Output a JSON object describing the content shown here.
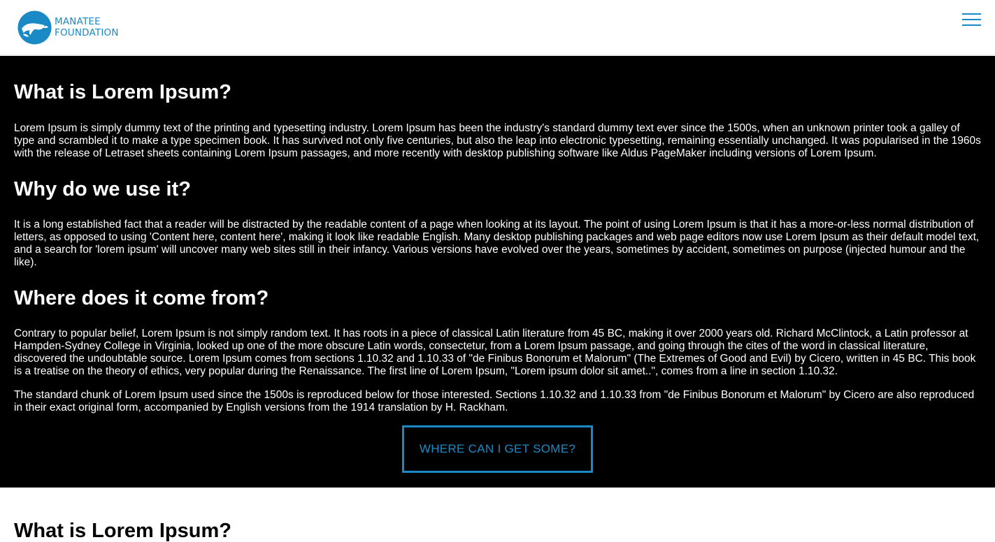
{
  "header": {
    "logo_line1": "MANATEE",
    "logo_line2": "FOUNDATION",
    "menu_icon": "hamburger-menu-icon",
    "brand_color": "#1a8ac6"
  },
  "dark_section": {
    "heading1": "What is Lorem Ipsum?",
    "para1": "Lorem Ipsum is simply dummy text of the printing and typesetting industry. Lorem Ipsum has been the industry's standard dummy text ever since the 1500s, when an unknown printer took a galley of type and scrambled it to make a type specimen book. It has survived not only five centuries, but also the leap into electronic typesetting, remaining essentially unchanged. It was popularised in the 1960s with the release of Letraset sheets containing Lorem Ipsum passages, and more recently with desktop publishing software like Aldus PageMaker including versions of Lorem Ipsum.",
    "heading2": "Why do we use it?",
    "para2": "It is a long established fact that a reader will be distracted by the readable content of a page when looking at its layout. The point of using Lorem Ipsum is that it has a more-or-less normal distribution of letters, as opposed to using 'Content here, content here', making it look like readable English. Many desktop publishing packages and web page editors now use Lorem Ipsum as their default model text, and a search for 'lorem ipsum' will uncover many web sites still in their infancy. Various versions have evolved over the years, sometimes by accident, sometimes on purpose (injected humour and the like).",
    "heading3": "Where does it come from?",
    "para3": "Contrary to popular belief, Lorem Ipsum is not simply random text. It has roots in a piece of classical Latin literature from 45 BC, making it over 2000 years old. Richard McClintock, a Latin professor at Hampden-Sydney College in Virginia, looked up one of the more obscure Latin words, consectetur, from a Lorem Ipsum passage, and going through the cites of the word in classical literature, discovered the undoubtable source. Lorem Ipsum comes from sections 1.10.32 and 1.10.33 of \"de Finibus Bonorum et Malorum\" (The Extremes of Good and Evil) by Cicero, written in 45 BC. This book is a treatise on the theory of ethics, very popular during the Renaissance. The first line of Lorem Ipsum, \"Lorem ipsum dolor sit amet..\", comes from a line in section 1.10.32.",
    "para4": "The standard chunk of Lorem Ipsum used since the 1500s is reproduced below for those interested. Sections 1.10.32 and 1.10.33 from \"de Finibus Bonorum et Malorum\" by Cicero are also reproduced in their exact original form, accompanied by English versions from the 1914 translation by H. Rackham.",
    "cta_label": "WHERE CAN I GET SOME?"
  },
  "light_section": {
    "heading1": "What is Lorem Ipsum?"
  }
}
